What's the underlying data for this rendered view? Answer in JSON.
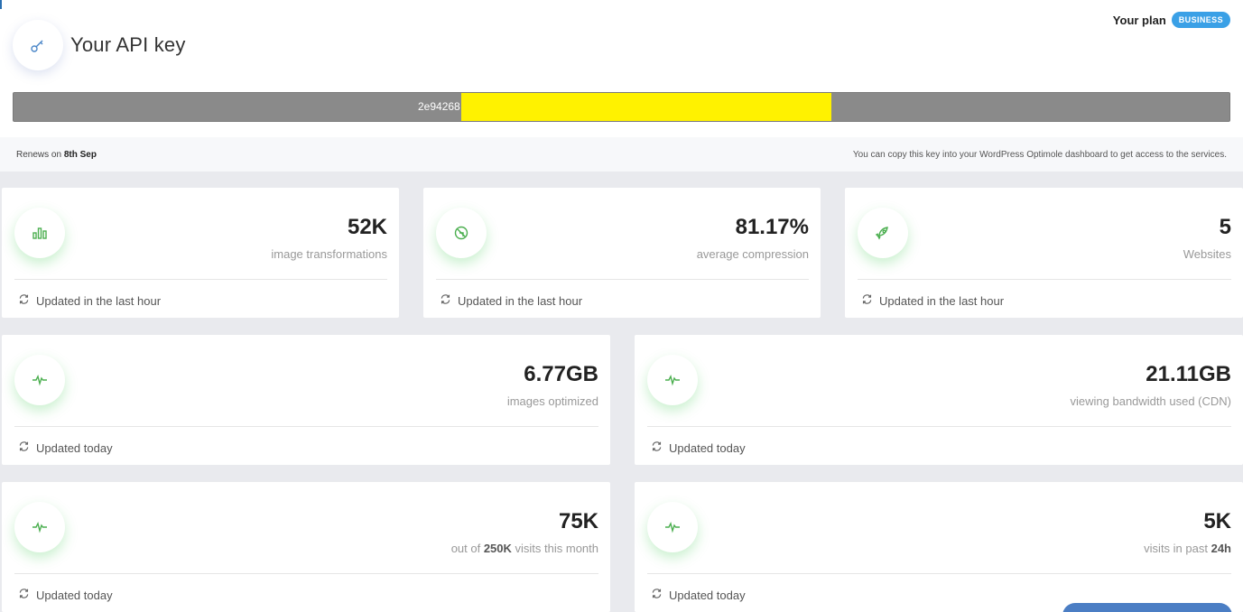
{
  "api": {
    "title": "Your API key",
    "plan_label": "Your plan",
    "plan_badge": "BUSINESS",
    "key_visible": "2e94268",
    "renew_prefix": "Renews on ",
    "renew_date": "8th Sep",
    "copy_hint": "You can copy this key into your WordPress Optimole dashboard to get access to the services."
  },
  "cards": {
    "transformations": {
      "value": "52K",
      "label": "image transformations",
      "updated": "Updated in the last hour",
      "icon": "bar-chart-icon"
    },
    "compression": {
      "value": "81.17%",
      "label": "average compression",
      "updated": "Updated in the last hour",
      "icon": "compress-icon"
    },
    "websites": {
      "value": "5",
      "label": "Websites",
      "updated": "Updated in the last hour",
      "icon": "rocket-icon"
    },
    "optimized": {
      "value": "6.77GB",
      "label": "images optimized",
      "updated": "Updated today",
      "icon": "pulse-icon"
    },
    "bandwidth": {
      "value": "21.11GB",
      "label": "viewing bandwidth used (CDN)",
      "updated": "Updated today",
      "icon": "pulse-icon"
    },
    "visits_month": {
      "value": "75K",
      "label_prefix": "out of ",
      "label_bold": "250K",
      "label_suffix": " visits this month",
      "updated": "Updated today",
      "icon": "pulse-icon"
    },
    "visits_day": {
      "value": "5K",
      "label_prefix": "visits in past ",
      "label_bold": "24h",
      "updated": "Updated today",
      "icon": "pulse-icon"
    }
  },
  "colors": {
    "accent_green": "#4caf50",
    "badge_blue": "#3aa0e6",
    "redaction": "#fff200",
    "key_bar": "#8a8a8a"
  }
}
